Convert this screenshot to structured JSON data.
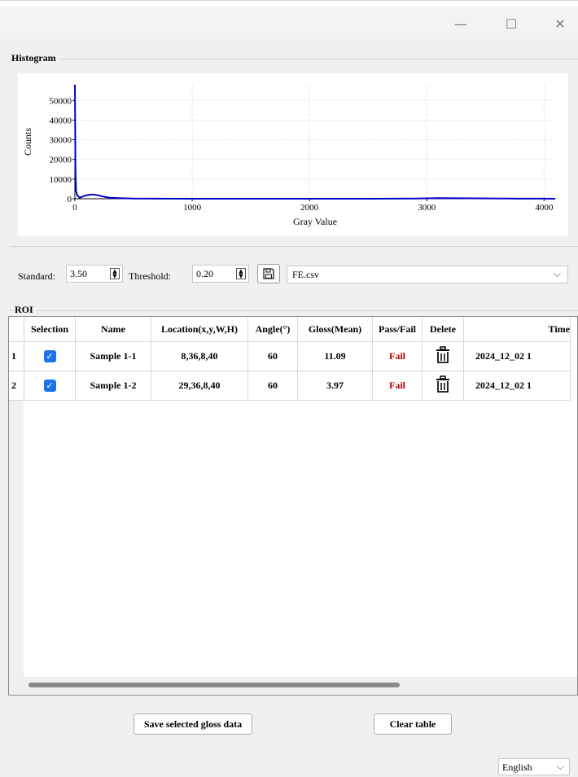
{
  "window": {
    "minimize_icon": "—",
    "maximize_icon": "☐",
    "close_icon": "✕"
  },
  "histogram": {
    "group_title": "Histogram"
  },
  "chart_data": {
    "type": "line",
    "xlabel": "Gray Value",
    "ylabel": "Counts",
    "xlim": [
      0,
      4095
    ],
    "ylim": [
      0,
      58000
    ],
    "x_ticks": [
      "0",
      "1000",
      "2000",
      "3000",
      "4000"
    ],
    "y_ticks": [
      "0",
      "10000",
      "20000",
      "30000",
      "40000",
      "50000"
    ],
    "grid": true,
    "line_color": "#0000cc",
    "series": [
      {
        "x": [
          0,
          5,
          10,
          20,
          40,
          70,
          100,
          150,
          200,
          250,
          300,
          400,
          500,
          700,
          1000,
          1500,
          2000,
          2500,
          2900,
          3100,
          3400,
          3700,
          4000,
          4095
        ],
        "values": [
          58000,
          15000,
          4000,
          1800,
          500,
          1200,
          1800,
          2200,
          1700,
          1000,
          500,
          250,
          100,
          40,
          20,
          10,
          10,
          20,
          100,
          300,
          200,
          100,
          50,
          0
        ]
      }
    ]
  },
  "controls": {
    "standard_label": "Standard:",
    "standard_value": "3.50",
    "threshold_label": "Threshold:",
    "threshold_value": "0.20",
    "save_icon": "save-icon",
    "file_value": "FE.csv"
  },
  "roi": {
    "group_title": "ROI",
    "columns": [
      "Selection",
      "Name",
      "Location(x,y,W,H)",
      "Angle(°)",
      "Gloss(Mean)",
      "Pass/Fail",
      "Delete",
      "Time"
    ],
    "rows": [
      {
        "index": "1",
        "checked": "✓",
        "name": "Sample 1-1",
        "location": "8,36,8,40",
        "angle": "60",
        "gloss": "11.09",
        "pass_fail": "Fail",
        "time": "2024_12_02 1"
      },
      {
        "index": "2",
        "checked": "✓",
        "name": "Sample 1-2",
        "location": "29,36,8,40",
        "angle": "60",
        "gloss": "3.97",
        "pass_fail": "Fail",
        "time": "2024_12_02 1"
      }
    ]
  },
  "buttons": {
    "save_selected": "Save selected gloss data",
    "clear_table": "Clear table"
  },
  "language": {
    "value": "English"
  }
}
